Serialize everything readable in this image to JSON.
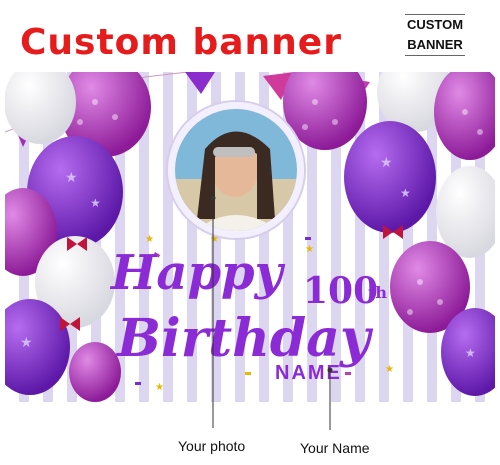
{
  "heading": "Custom banner",
  "corner_label": {
    "line1": "CUSTOM",
    "line2": "BANNER"
  },
  "banner": {
    "happy": "Happy",
    "age": "100",
    "suffix": "th",
    "birthday": "Birthday",
    "name": "NAME"
  },
  "captions": {
    "photo": "Your photo",
    "name": "Your Name"
  },
  "colors": {
    "heading": "#e61b1b",
    "text": "#8a2bd6",
    "balloon_purple": "#7a25c8",
    "balloon_magenta": "#b030b8"
  }
}
